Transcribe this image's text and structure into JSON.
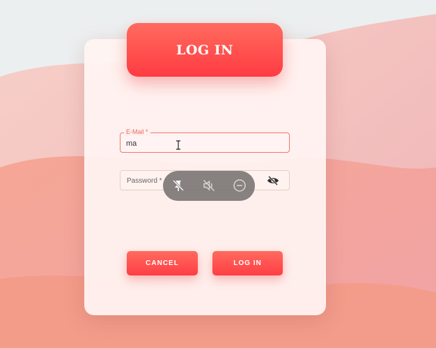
{
  "header": {
    "title": "LOG IN"
  },
  "email": {
    "label": "E-Mail *",
    "value": "ma"
  },
  "password": {
    "label": "Password *"
  },
  "overlay": {
    "icons": [
      "unpin-icon",
      "volume-off-icon",
      "minus-circle-icon"
    ]
  },
  "password_toggle_icon": "eye-off-icon",
  "buttons": {
    "cancel": "CANCEL",
    "login": "LOG IN"
  },
  "colors": {
    "accent": "#ff4a4f",
    "accent_light": "#ff6b5e",
    "overlay": "#767271"
  }
}
